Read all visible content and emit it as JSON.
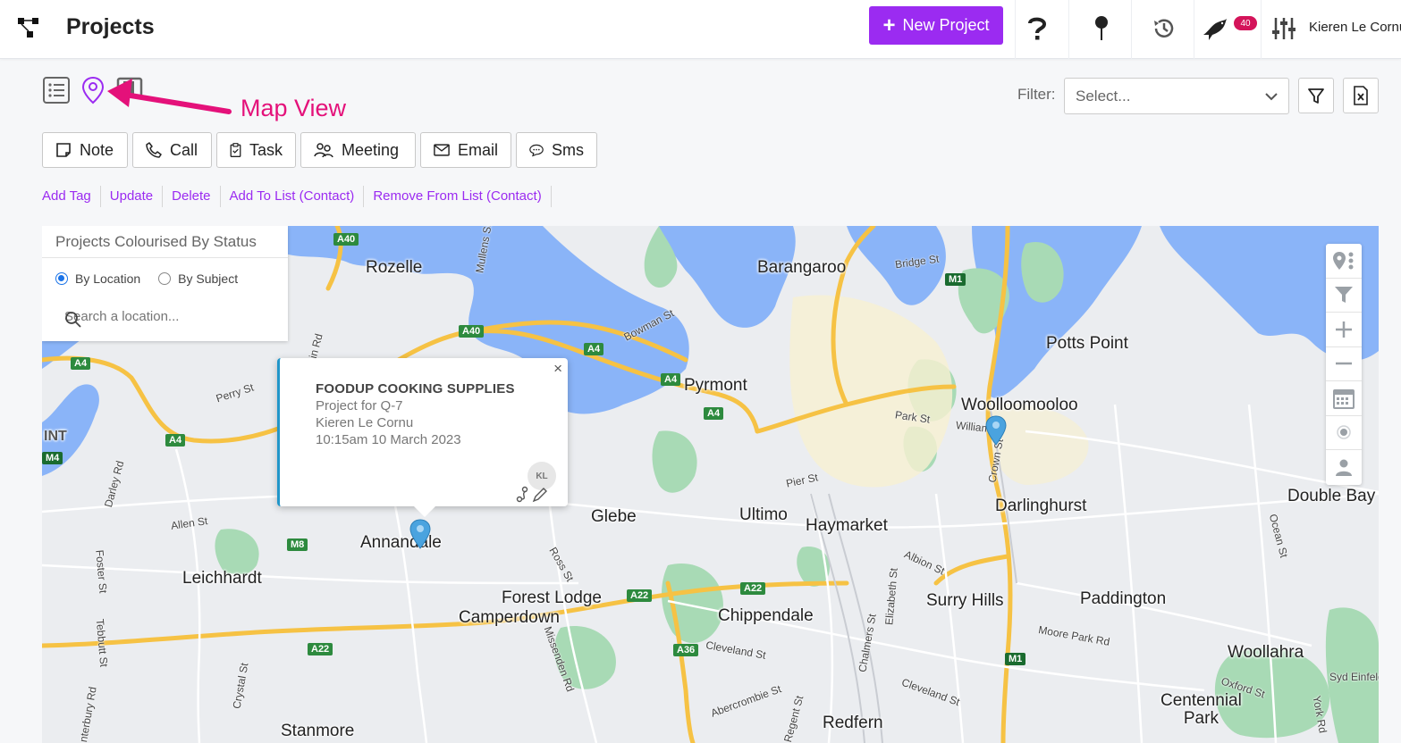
{
  "header": {
    "title": "Projects",
    "new_project_label": "New Project",
    "notification_count": "40",
    "user_name": "Kieren Le Cornu"
  },
  "annotation": {
    "label": "Map View",
    "color": "#e4117a"
  },
  "filter": {
    "label": "Filter:",
    "placeholder": "Select..."
  },
  "actions": [
    {
      "label": "Note",
      "icon": "note-icon"
    },
    {
      "label": "Call",
      "icon": "phone-icon"
    },
    {
      "label": "Task",
      "icon": "clipboard-icon"
    },
    {
      "label": "Meeting",
      "icon": "meeting-icon"
    },
    {
      "label": "Email",
      "icon": "envelope-icon"
    },
    {
      "label": "Sms",
      "icon": "sms-icon"
    }
  ],
  "links": [
    "Add Tag",
    "Update",
    "Delete",
    "Add To List (Contact)",
    "Remove From List (Contact)"
  ],
  "map_panel": {
    "title": "Projects Colourised By Status",
    "radio_location": "By Location",
    "radio_subject": "By Subject",
    "search_placeholder": "Search a location..."
  },
  "popup": {
    "title": "FOODUP COOKING SUPPLIES",
    "line1": "Project for Q-7",
    "line2": "Kieren Le Cornu",
    "line3": "10:15am 10 March 2023",
    "avatar": "KL",
    "close": "×"
  },
  "map_labels": {
    "rozelle": "Rozelle",
    "barangaroo": "Barangaroo",
    "potts_point": "Potts Point",
    "pyrmont": "Pyrmont",
    "woolloomooloo": "Woolloomooloo",
    "int": "INT",
    "glebe": "Glebe",
    "ultimo": "Ultimo",
    "haymarket": "Haymarket",
    "darlinghurst": "Darlinghurst",
    "double_bay": "Double Bay",
    "annandale": "Annandale",
    "leichhardt": "Leichhardt",
    "forest_lodge": "Forest Lodge",
    "camperdown": "Camperdown",
    "chippendale": "Chippendale",
    "surry_hills": "Surry Hills",
    "paddington": "Paddington",
    "woollahra": "Woollahra",
    "centennial_park": "Centennial\nPark",
    "stanmore": "Stanmore",
    "redfern": "Redfern"
  },
  "street_labels": {
    "bridge_st": "Bridge St",
    "perry_st": "Perry St",
    "bowman_st": "Bowman St",
    "park_st": "Park St",
    "william_st": "William",
    "crown_st": "Crown St",
    "pier_st": "Pier St",
    "allen_st": "Allen St",
    "darley_rd": "Darley Rd",
    "foster_st": "Foster St",
    "ross_st": "Ross St",
    "albion_st": "Albion St",
    "ocean_st": "Ocean St",
    "moore_park_rd": "Moore Park Rd",
    "cleveland_st": "Cleveland St",
    "cleveland_st2": "Cleveland St",
    "missenden_rd": "Missenden Rd",
    "elizabeth_st": "Elizabeth St",
    "chalmers_st": "Chalmers St",
    "crystal_st": "Crystal St",
    "tebbutt_st": "Tebbutt St",
    "abercrombie_st": "Abercrombie St",
    "regent_st": "Regent St",
    "oxford_st": "Oxford St",
    "syd_einfeld": "Syd Einfeld",
    "york_rd": "York Rd",
    "canterbury_rd": "nterbury Rd",
    "mullens_st": "Mullens St",
    "balmain_rd": "almain Rd"
  },
  "shields": {
    "a40_1": "A40",
    "a40_2": "A40",
    "a4_1": "A4",
    "a4_2": "A4",
    "a4_3": "A4",
    "a4_4": "A4",
    "a4_5": "A4",
    "m1_1": "M1",
    "m1_2": "M1",
    "m4": "M4",
    "m8": "M8",
    "a22_1": "A22",
    "a22_2": "A22",
    "a22_3": "A22",
    "a36": "A36"
  },
  "colors": {
    "accent": "#9b2bf1",
    "water": "#8ab4f8",
    "park": "#a8dab5",
    "highway": "#f6c244",
    "pin": "#4aa3df"
  }
}
